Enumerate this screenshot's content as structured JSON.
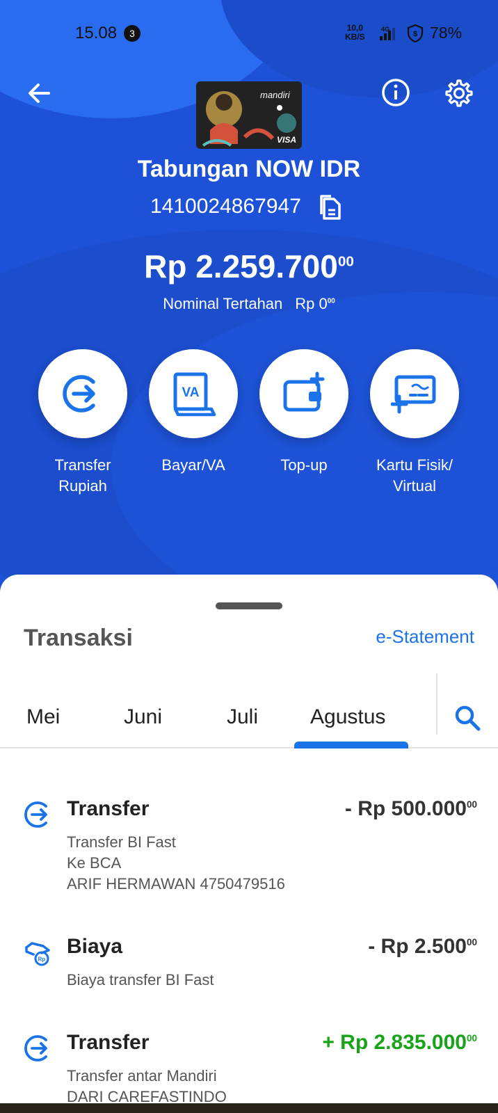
{
  "status_bar": {
    "time": "15.08",
    "notification_count": "3",
    "net_speed_value": "10,0",
    "net_speed_unit": "KB/S",
    "network": "4G",
    "battery": "78%"
  },
  "header": {
    "back_icon": "arrow-left-icon",
    "info_icon": "info-icon",
    "settings_icon": "gear-icon",
    "card_brand": "mandiri",
    "card_network": "VISA"
  },
  "account": {
    "name": "Tabungan NOW IDR",
    "number": "1410024867947",
    "balance_main": "Rp 2.259.700",
    "balance_cents": "00",
    "hold_label": "Nominal Tertahan",
    "hold_amount_main": "Rp 0",
    "hold_amount_cents": "00"
  },
  "actions": [
    {
      "label": "Transfer\nRupiah",
      "icon": "transfer-icon"
    },
    {
      "label": "Bayar/VA",
      "icon": "va-icon"
    },
    {
      "label": "Top-up",
      "icon": "wallet-add-icon"
    },
    {
      "label": "Kartu Fisik/\nVirtual",
      "icon": "card-add-icon"
    }
  ],
  "transactions_panel": {
    "title": "Transaksi",
    "estatement_link": "e-Statement",
    "tabs": [
      "Mei",
      "Juni",
      "Juli",
      "Agustus"
    ],
    "active_tab": "Agustus",
    "search_icon": "search-icon"
  },
  "transactions": [
    {
      "type": "Transfer",
      "amount_main": "- Rp 500.000",
      "amount_cents": "00",
      "direction": "debit",
      "lines": [
        "Transfer BI Fast",
        "Ke BCA",
        "ARIF HERMAWAN 4750479516"
      ]
    },
    {
      "type": "Biaya",
      "amount_main": "- Rp 2.500",
      "amount_cents": "00",
      "direction": "debit",
      "lines": [
        "Biaya transfer BI Fast"
      ]
    },
    {
      "type": "Transfer",
      "amount_main": "+ Rp 2.835.000",
      "amount_cents": "00",
      "direction": "credit",
      "lines": [
        "Transfer antar Mandiri",
        "DARI CAREFASTINDO"
      ]
    }
  ],
  "colors": {
    "hero_blue": "#1d52d8",
    "accent_blue": "#1a73e8",
    "credit_green": "#19a319"
  }
}
